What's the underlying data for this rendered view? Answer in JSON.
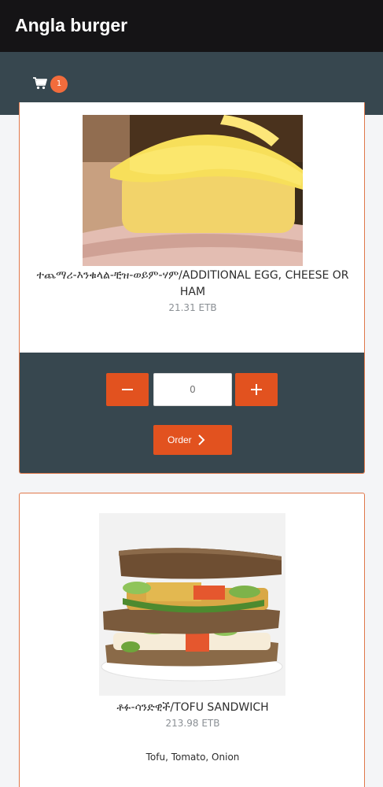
{
  "app": {
    "title": "Angla burger"
  },
  "cart": {
    "icon": "cart-icon",
    "count": "1",
    "badge_color": "#f26c3c"
  },
  "colors": {
    "accent": "#e2521f",
    "panel": "#37474f",
    "topbar": "#151416"
  },
  "products": [
    {
      "name": "ተጨማሪ-እንቁላል-ቺዝ-ወይም-ሃም/ADDITIONAL EGG, CHEESE OR HAM",
      "price": "21.31 ETB",
      "quantity_placeholder": "0",
      "order_label": "Order"
    },
    {
      "name": "ቶፉ-ሳንድዊች/TOFU SANDWICH",
      "price": "213.98 ETB",
      "description": "Tofu, Tomato, Onion"
    }
  ]
}
